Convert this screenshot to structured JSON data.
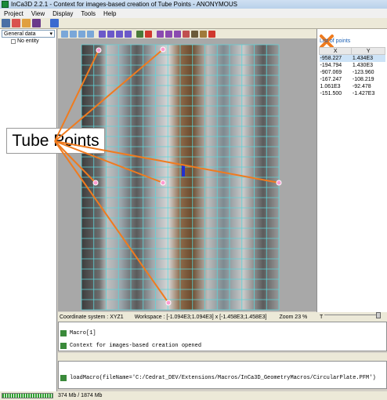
{
  "window": {
    "title": "InCa3D 2.2.1 - Context for images-based creation of Tube Points - ANONYMOUS"
  },
  "menu": {
    "items": [
      "Project",
      "View",
      "Display",
      "Tools",
      "Help"
    ]
  },
  "left_panel": {
    "selector_value": "General data",
    "entity": "No entity"
  },
  "points": {
    "title": "List of points",
    "columns": [
      "X",
      "Y"
    ],
    "rows": [
      [
        "-958.227",
        "1.434E3"
      ],
      [
        "-194.794",
        "1.430E3"
      ],
      [
        "-907.069",
        "-123.960"
      ],
      [
        "-167.247",
        "-108.219"
      ],
      [
        "1.061E3",
        "-92.478"
      ],
      [
        "-151.500",
        "-1.427E3"
      ]
    ]
  },
  "status": {
    "coordinate_system": "Coordinate system :  XYZ1",
    "workspace": "Workspace : [-1.094E3;1.094E3] x [-1.458E3;1.458E3]",
    "zoom": "Zoom   23 %",
    "slider_label": "T"
  },
  "console": {
    "line1": "Macro[1]",
    "line2": "Context for images-based creation opened"
  },
  "macro": {
    "line": "loadMacro(fileName='C:/Cedrat_DEV/Extensions/Macros/InCa3D_GeometryMacros/CircularPlate.PFM')"
  },
  "bottom": {
    "memory": "374 Mb / 1874 Mb"
  },
  "callout": {
    "label": "Tube Points"
  },
  "colors": {
    "grid": "#5fd3d8",
    "arrow": "#f07b1e",
    "accent": "#1a5fb4"
  }
}
